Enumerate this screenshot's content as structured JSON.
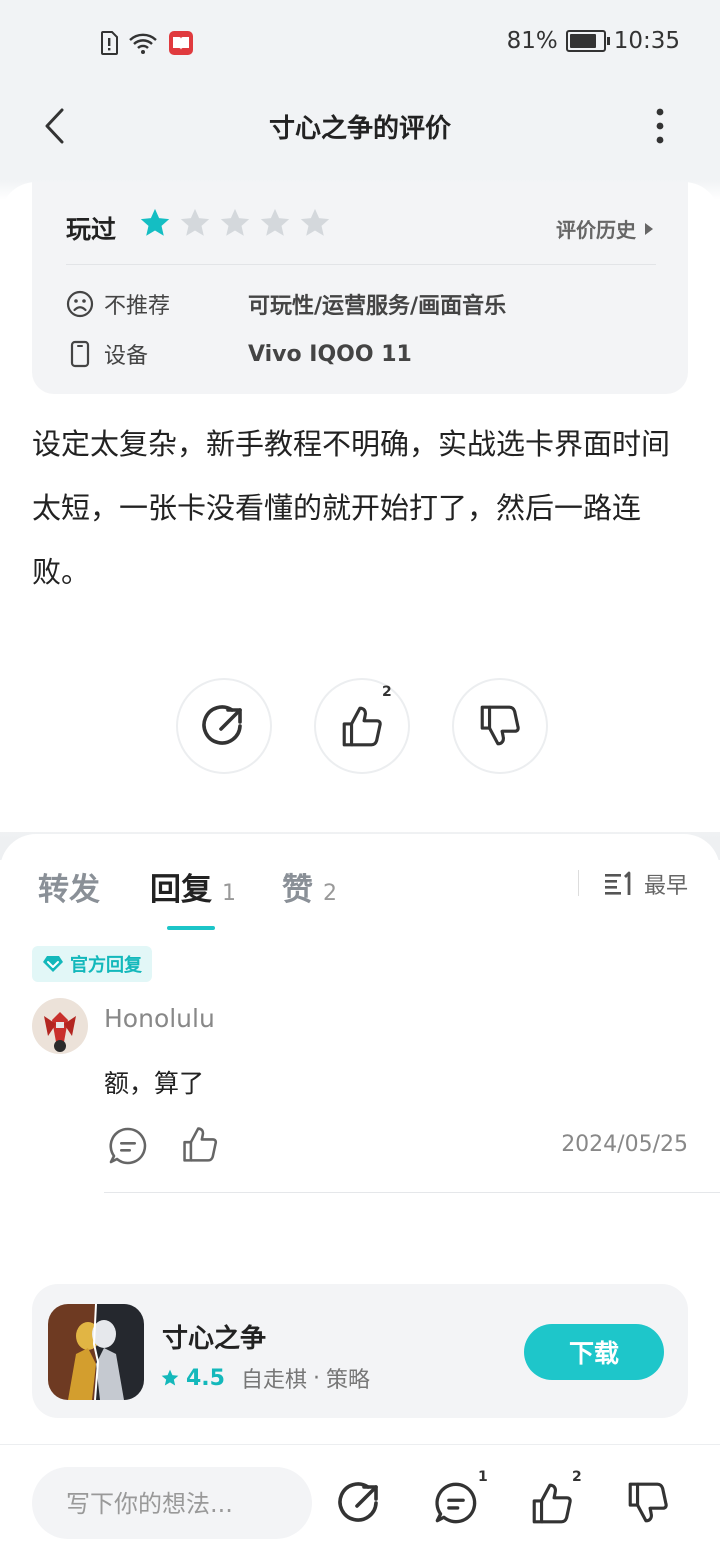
{
  "status_bar": {
    "battery_text": "81%",
    "battery_level": 0.81,
    "time": "10:35"
  },
  "header": {
    "title": "寸心之争的评价"
  },
  "review": {
    "played_label": "玩过",
    "stars_filled": 1,
    "stars_total": 5,
    "history_label": "评价历史",
    "recommend_label": "不推荐",
    "tags": "可玩性/运营服务/画面音乐",
    "device_label": "设备",
    "device_value": "Vivo IQOO 11",
    "body": "设定太复杂，新手教程不明确，实战选卡界面时间太短，一张卡没看懂的就开始打了，然后一路连败。",
    "like_count": "2"
  },
  "tabs": {
    "forward": "转发",
    "reply": "回复",
    "reply_count": "1",
    "like": "赞",
    "like_count": "2",
    "sort_label": "最早"
  },
  "official_reply": {
    "badge_label": "官方回复",
    "username": "Honolulu",
    "text": "额，算了",
    "date": "2024/05/25"
  },
  "app": {
    "name": "寸心之争",
    "rating": "4.5",
    "genre": "自走棋",
    "separator": "·",
    "category": "策略",
    "download_label": "下载"
  },
  "bottom_bar": {
    "placeholder": "写下你的想法...",
    "comment_count": "1",
    "like_count": "2"
  },
  "colors": {
    "accent": "#1ec6ca",
    "star_filled": "#14bec3",
    "star_empty": "#d4d8dc"
  }
}
